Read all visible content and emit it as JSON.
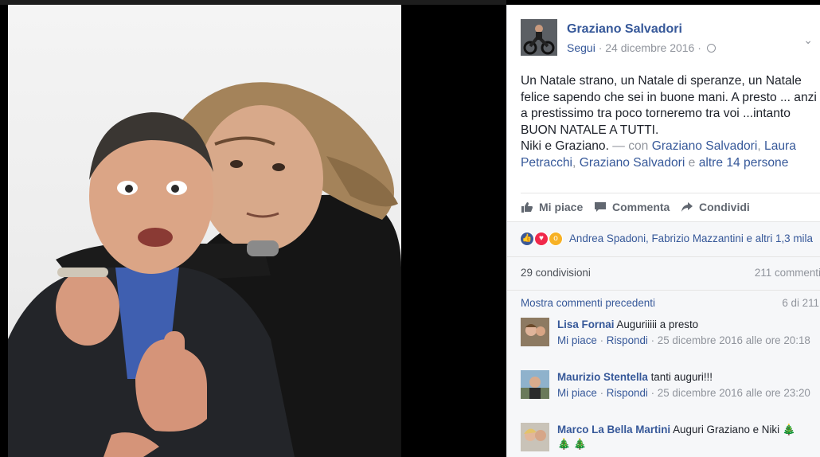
{
  "photo": {
    "alt": "Niki e Graziano"
  },
  "post": {
    "author": "Graziano Salvadori",
    "follow": "Segui",
    "date": "24 dicembre 2016",
    "sep": "·",
    "text_main": "Un Natale strano, un Natale di speranze, un Natale felice sapendo che sei in buone mani. A presto ... anzi a prestissimo tra poco torneremo tra voi ...intanto BUON NATALE A TUTTI.",
    "signature": "Niki e Graziano.",
    "with_prefix": "— con",
    "tag1": "Graziano Salvadori",
    "comma": ",",
    "tag2": "Laura Petracchi",
    "tag3": "Graziano Salvadori",
    "and": "e",
    "others": "altre 14 persone"
  },
  "actions": {
    "like": "Mi piace",
    "comment": "Commenta",
    "share": "Condividi"
  },
  "reactions": {
    "icons": [
      "like-reaction-icon",
      "love-reaction-icon",
      "wow-reaction-icon"
    ],
    "colors": {
      "like": "#3b5998",
      "love": "#f0284a",
      "wow": "#f7b125"
    },
    "summary": "Andrea Spadoni, Fabrizio Mazzantini e altri 1,3 mila"
  },
  "counts": {
    "shares": "29 condivisioni",
    "comments": "211 commenti"
  },
  "comments": {
    "more": "Mostra commenti precedenti",
    "of": "6 di 211",
    "items": [
      {
        "name": "Lisa Fornai",
        "text": "Auguriiiii a presto",
        "like": "Mi piace",
        "reply": "Rispondi",
        "time": "25 dicembre 2016 alle ore 20:18"
      },
      {
        "name": "Maurizio Stentella",
        "text": "tanti auguri!!!",
        "like": "Mi piace",
        "reply": "Rispondi",
        "time": "25 dicembre 2016 alle ore 23:20"
      },
      {
        "name": "Marco La Bella Martini",
        "text": "Auguri Graziano e Niki",
        "emoji": "🎄",
        "emoji2": "🎄 🎄"
      }
    ]
  },
  "colors": {
    "link": "#365899",
    "text": "#1d2129",
    "muted": "#90949c",
    "panel": "#f6f7f9"
  }
}
